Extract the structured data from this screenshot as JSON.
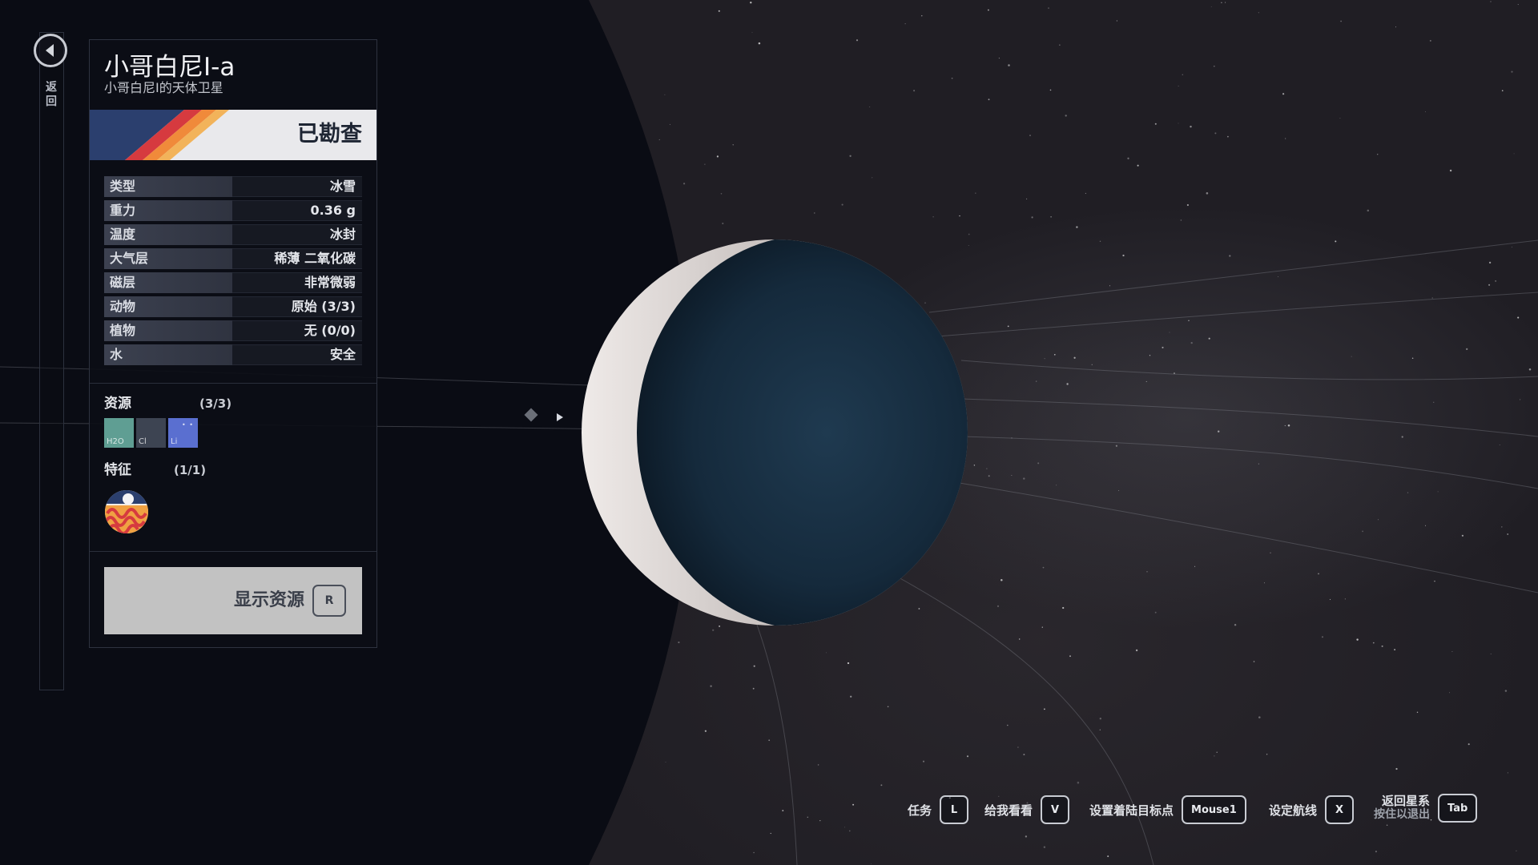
{
  "nav": {
    "back_label": "返回",
    "back_icon": "chevron-left-icon"
  },
  "body": {
    "name": "小哥白尼I-a",
    "subtitle": "小哥白尼I的天体卫星",
    "survey_status": "已勘查"
  },
  "stats": [
    {
      "label": "类型",
      "value": "冰雪"
    },
    {
      "label": "重力",
      "value": "0.36 g"
    },
    {
      "label": "温度",
      "value": "冰封"
    },
    {
      "label": "大气层",
      "value": "稀薄 二氧化碳"
    },
    {
      "label": "磁层",
      "value": "非常微弱"
    },
    {
      "label": "动物",
      "value": "原始 (3/3)"
    },
    {
      "label": "植物",
      "value": "无 (0/0)"
    },
    {
      "label": "水",
      "value": "安全"
    }
  ],
  "resources": {
    "title": "资源",
    "count": "(3/3)",
    "items": [
      {
        "symbol": "H2O",
        "color": "#5f9e93"
      },
      {
        "symbol": "Cl",
        "color": "#3d4452"
      },
      {
        "symbol": "Li",
        "color": "#5a6fd0"
      }
    ]
  },
  "traits": {
    "title": "特征",
    "count": "(1/1)",
    "icon": "biome-trait-icon"
  },
  "show_resources": {
    "label": "显示资源",
    "key": "R"
  },
  "hints": [
    {
      "label": "任务",
      "key": "L"
    },
    {
      "label": "给我看看",
      "key": "V"
    },
    {
      "label": "设置着陆目标点",
      "key": "Mouse1"
    },
    {
      "label": "设定航线",
      "key": "X"
    },
    {
      "label": "返回星系",
      "sublabel": "按住以退出",
      "key": "Tab"
    }
  ],
  "colors": {
    "panel_bg": "#0c0e16",
    "banner_bg": "#e9e9ec",
    "stripe_blue": "#2b3f6e",
    "stripe_red": "#d63a3f",
    "stripe_orange": "#f08a3a",
    "stripe_yellow": "#f2b35a",
    "planet_dark": "#1c3448",
    "planet_light": "#e8e4e2"
  }
}
